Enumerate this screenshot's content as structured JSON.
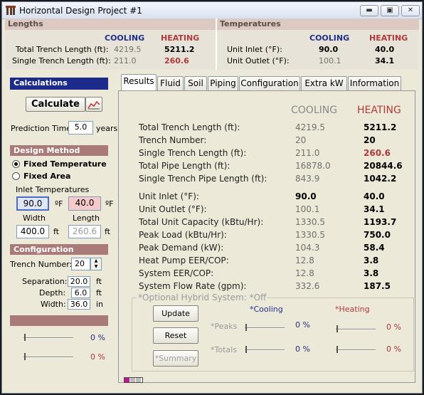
{
  "window": {
    "title": "Horizontal Design Project #1",
    "minimize": "▬",
    "restore": "▣",
    "close": "✕"
  },
  "summary": {
    "lengths": {
      "header": "Lengths",
      "cooling_label": "COOLING",
      "heating_label": "HEATING",
      "rows": [
        {
          "label": "Total Trench Length (ft):",
          "cooling": "4219.5",
          "heating": "5211.2"
        },
        {
          "label": "Single Trench Length (ft):",
          "cooling": "211.0",
          "heating": "260.6"
        }
      ]
    },
    "temperatures": {
      "header": "Temperatures",
      "cooling_label": "COOLING",
      "heating_label": "HEATING",
      "rows": [
        {
          "label": "Unit Inlet (°F):",
          "cooling": "90.0",
          "heating": "40.0"
        },
        {
          "label": "Unit Outlet (°F):",
          "cooling": "100.1",
          "heating": "34.1"
        }
      ]
    }
  },
  "left": {
    "calculations_header": "Calculations",
    "calculate_button": "Calculate",
    "prediction_label": "Prediction Time:",
    "prediction_value": "5.0",
    "prediction_unit": "years",
    "design_method_header": "Design Method",
    "fixed_temperature": "Fixed Temperature",
    "fixed_area": "Fixed Area",
    "inlet_temps_label": "Inlet Temperatures",
    "inlet_cool": "90.0",
    "inlet_heat": "40.0",
    "deg_unit": "ºF",
    "width_label": "Width",
    "length_label": "Length",
    "width_value": "400.0",
    "length_value": "260.6",
    "ft": "ft",
    "configuration_header": "Configuration",
    "trench_number_label": "Trench Number:",
    "trench_number_value": "20",
    "separation_label": "Separation:",
    "separation_value": "20.0",
    "depth_label": "Depth:",
    "depth_value": "6.0",
    "width2_label": "Width:",
    "width2_value": "36.0",
    "in_unit": "in",
    "slider1_value": "0 %",
    "slider2_value": "0 %"
  },
  "tabs": [
    "Results",
    "Fluid",
    "Soil",
    "Piping",
    "Configuration",
    "Extra kW",
    "Information"
  ],
  "results": {
    "cooling_label": "COOLING",
    "heating_label": "HEATING",
    "rows": [
      {
        "label": "Total Trench Length (ft):",
        "cooling": "4219.5",
        "heating": "5211.2"
      },
      {
        "label": "Trench Number:",
        "cooling": "20",
        "heating": "20"
      },
      {
        "label": "Single Trench Length (ft):",
        "cooling": "211.0",
        "heating": "260.6"
      },
      {
        "label": "Total Pipe Length (ft):",
        "cooling": "16878.0",
        "heating": "20844.6"
      },
      {
        "label": "Single Trench Pipe Length (ft):",
        "cooling": "843.9",
        "heating": "1042.2"
      },
      {
        "label": "Unit Inlet (°F):",
        "cooling": "90.0",
        "heating": "40.0"
      },
      {
        "label": "Unit Outlet (°F):",
        "cooling": "100.1",
        "heating": "34.1"
      },
      {
        "label": "Total Unit Capacity (kBtu/Hr):",
        "cooling": "1330.5",
        "heating": "1193.7"
      },
      {
        "label": "Peak Load (kBtu/Hr):",
        "cooling": "1330.5",
        "heating": "750.0"
      },
      {
        "label": "Peak Demand (kW):",
        "cooling": "104.3",
        "heating": "58.4"
      },
      {
        "label": "Heat Pump EER/COP:",
        "cooling": "12.8",
        "heating": "3.8"
      },
      {
        "label": "System EER/COP:",
        "cooling": "12.8",
        "heating": "3.8"
      },
      {
        "label": "System Flow Rate (gpm):",
        "cooling": "332.6",
        "heating": "187.5"
      }
    ]
  },
  "hybrid": {
    "title": "*Optional Hybrid System:  *Off",
    "update_button": "Update",
    "reset_button": "Reset",
    "summary_button": "*Summary",
    "cooling_label": "*Cooling",
    "heating_label": "*Heating",
    "peaks_label": "*Peaks",
    "totals_label": "*Totals",
    "peaks_cool": "0 %",
    "peaks_heat": "0 %",
    "totals_cool": "0 %",
    "totals_heat": "0 %"
  },
  "colors": {
    "cooling": "#1f2f8c",
    "heating": "#b03a3a",
    "calc_header": "#1c2a8a",
    "section_header": "#a87a78"
  }
}
